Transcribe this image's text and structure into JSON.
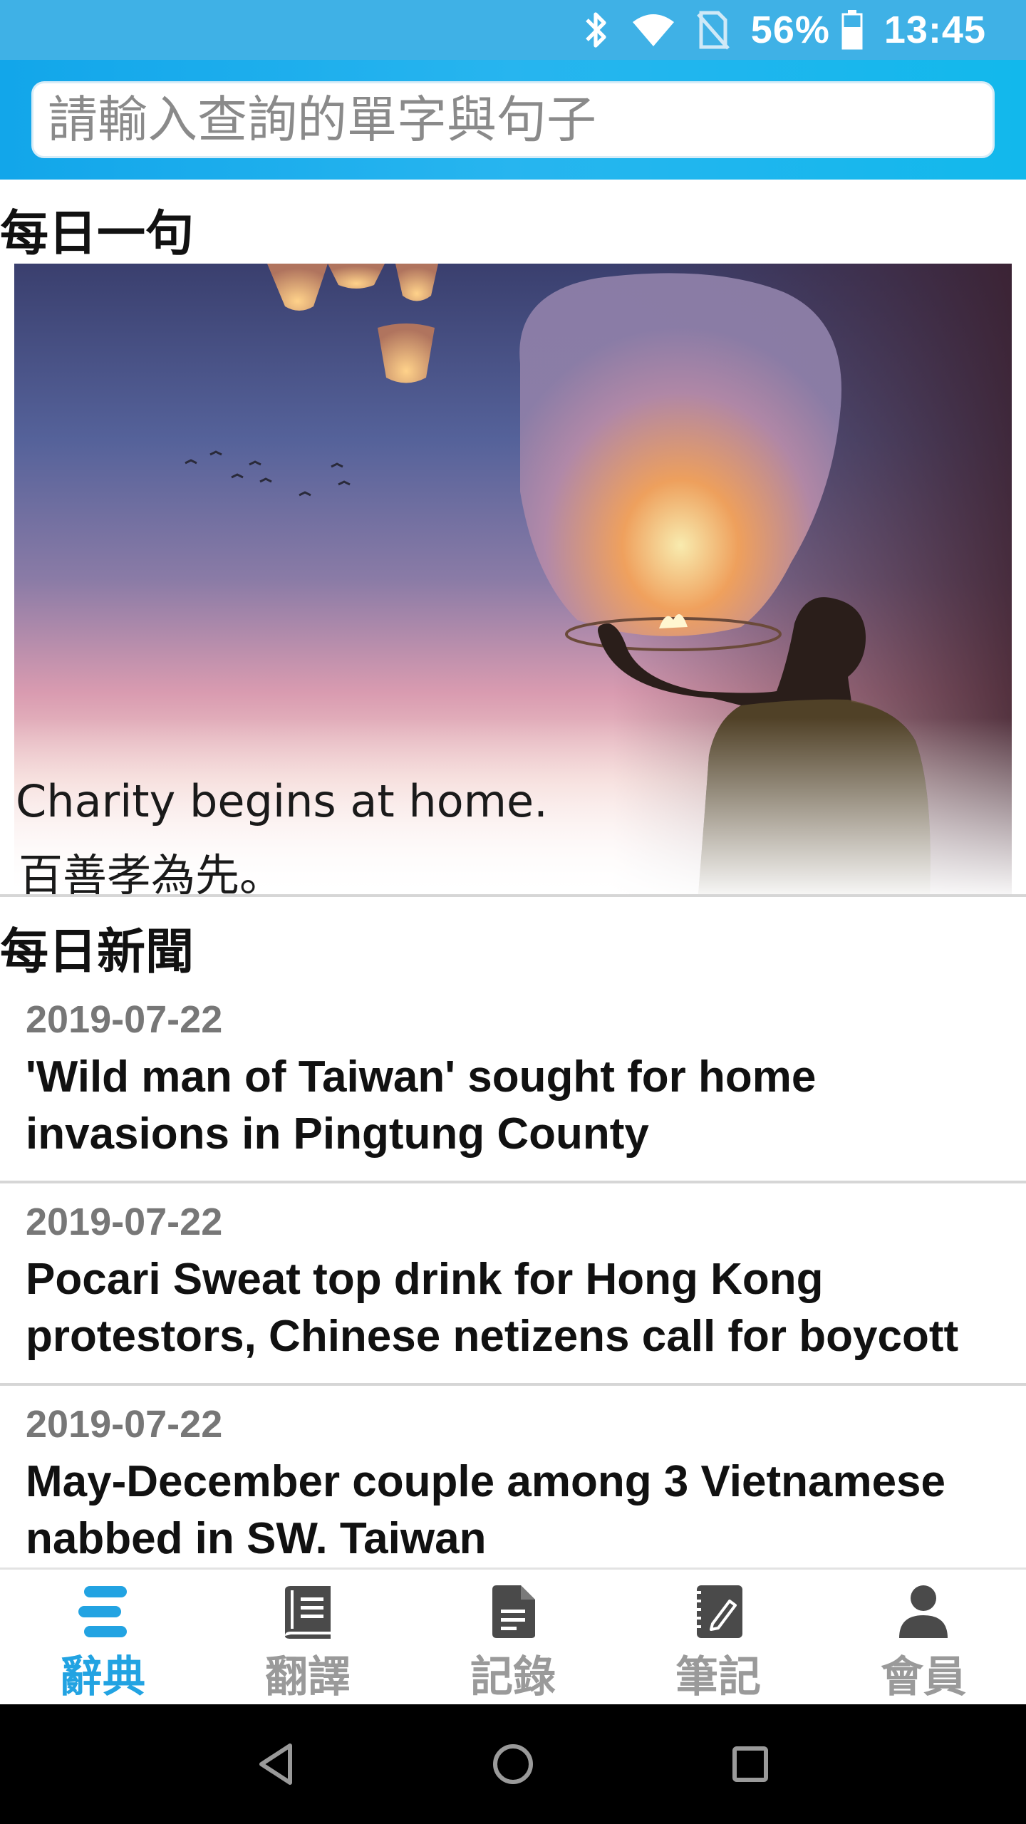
{
  "status_bar": {
    "battery_percent": "56%",
    "time": "13:45",
    "icons": [
      "bluetooth-icon",
      "wifi-icon",
      "no-sim-icon",
      "battery-icon"
    ]
  },
  "search": {
    "placeholder": "請輸入查詢的單字與句子"
  },
  "daily_sentence": {
    "section_title": "每日一句",
    "english": "Charity begins at home.",
    "chinese": "百善孝為先。"
  },
  "daily_news": {
    "section_title": "每日新聞",
    "items": [
      {
        "date": "2019-07-22",
        "headline": "'Wild man of Taiwan' sought for home invasions in Pingtung County"
      },
      {
        "date": "2019-07-22",
        "headline": "Pocari Sweat top drink for Hong Kong protestors, Chinese netizens call for boycott"
      },
      {
        "date": "2019-07-22",
        "headline": "May-December couple among 3 Vietnamese nabbed in SW. Taiwan"
      }
    ]
  },
  "bottom_nav": {
    "tabs": [
      {
        "label": "辭典",
        "icon": "dictionary-icon",
        "active": true
      },
      {
        "label": "翻譯",
        "icon": "translate-book-icon",
        "active": false
      },
      {
        "label": "記錄",
        "icon": "document-icon",
        "active": false
      },
      {
        "label": "筆記",
        "icon": "notebook-pen-icon",
        "active": false
      },
      {
        "label": "會員",
        "icon": "person-icon",
        "active": false
      }
    ]
  },
  "colors": {
    "header_blue": "#12a6ea",
    "status_bar": "#3fb1e6",
    "active_tab": "#22a3e2",
    "inactive_tab": "#9a9a9a"
  }
}
